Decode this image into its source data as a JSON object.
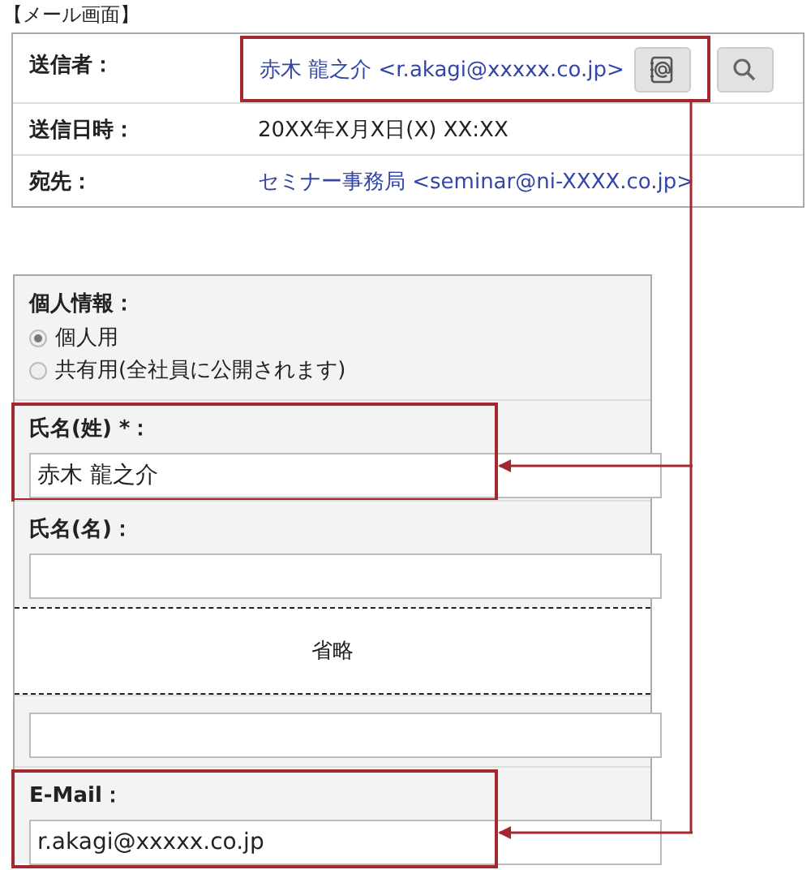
{
  "caption": "【メール画面】",
  "mail_header": {
    "rows": [
      {
        "kind": "sender",
        "label": "送信者：",
        "value": "赤木 龍之介 <r.akagi@xxxxx.co.jp>",
        "highlighted": true
      },
      {
        "kind": "text",
        "label": "送信日時：",
        "value": "20XX年X月X日(X) XX:XX",
        "highlighted": false
      },
      {
        "kind": "link",
        "label": "宛先：",
        "value": "セミナー事務局 <seminar@ni-XXXX.co.jp>",
        "highlighted": false
      }
    ]
  },
  "form": {
    "sections": [
      {
        "kind": "radio",
        "label": "個人情報：",
        "options": [
          {
            "label": "個人用",
            "selected": true
          },
          {
            "label": "共有用(全社員に公開されます)",
            "selected": false
          }
        ]
      },
      {
        "kind": "field",
        "label": "氏名(姓) *：",
        "value": "赤木 龍之介",
        "highlighted": true
      },
      {
        "kind": "field",
        "label": "氏名(名)：",
        "highlighted": false
      },
      {
        "kind": "omitted",
        "text": "省略"
      },
      {
        "kind": "field",
        "highlighted": false
      },
      {
        "kind": "field",
        "label": "E-Mail：",
        "value": "r.akagi@xxxxx.co.jp",
        "highlighted": true
      }
    ]
  }
}
